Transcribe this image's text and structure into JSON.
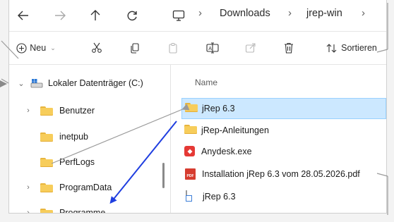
{
  "address": {
    "breadcrumbs": [
      "Downloads",
      "jrep-win"
    ],
    "nav_icons": [
      "back-arrow-icon",
      "forward-arrow-icon",
      "up-arrow-icon",
      "refresh-icon",
      "computer-icon"
    ]
  },
  "toolbar": {
    "new_label": "Neu",
    "sort_label": "Sortieren"
  },
  "sidebar": {
    "drive_label": "Lokaler Datenträger (C:)",
    "items": [
      {
        "label": "Benutzer",
        "expandable": true
      },
      {
        "label": "inetpub",
        "expandable": false
      },
      {
        "label": "PerfLogs",
        "expandable": false
      },
      {
        "label": "ProgramData",
        "expandable": true
      },
      {
        "label": "Programme",
        "expandable": true
      }
    ]
  },
  "content": {
    "column_header": "Name",
    "files": [
      {
        "name": "jRep 6.3",
        "type": "folder",
        "selected": true
      },
      {
        "name": "jRep-Anleitungen",
        "type": "folder",
        "selected": false
      },
      {
        "name": "Anydesk.exe",
        "type": "exe",
        "selected": false
      },
      {
        "name": "Installation jRep 6.3 vom 28.05.2026.pdf",
        "type": "pdf",
        "selected": false
      },
      {
        "name": "jRep 6.3",
        "type": "shortcut",
        "selected": false
      }
    ]
  },
  "colors": {
    "selection": "#cce8ff",
    "selection_border": "#99d1ff",
    "folder": "#f7cd5b",
    "annotation_arrow": "#1f3ee0",
    "callout_line": "#9a9a9a"
  }
}
